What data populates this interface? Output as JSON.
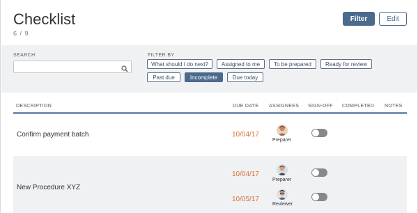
{
  "header": {
    "title": "Checklist",
    "count": "6 / 9"
  },
  "toolbar": {
    "filter_label": "Filter",
    "edit_label": "Edit"
  },
  "filters": {
    "search_label": "SEARCH",
    "search_value": "",
    "filter_by_label": "FILTER BY",
    "chips": [
      {
        "label": "What should I do next?",
        "active": false
      },
      {
        "label": "Assigned to me",
        "active": false
      },
      {
        "label": "To be prepared",
        "active": false
      },
      {
        "label": "Ready for review",
        "active": false
      },
      {
        "label": "Past due",
        "active": false
      },
      {
        "label": "Incomplete",
        "active": true
      },
      {
        "label": "Due today",
        "active": false
      }
    ]
  },
  "table": {
    "columns": [
      "DESCRIPTION",
      "DUE DATE",
      "ASSIGNEES",
      "SIGN-OFF",
      "COMPLETED",
      "NOTES"
    ],
    "rows": [
      {
        "description": "Confirm payment batch",
        "assignments": [
          {
            "due_date": "10/04/17",
            "role": "Preparer",
            "signed_off": false
          }
        ]
      },
      {
        "description": "New Procedure XYZ",
        "assignments": [
          {
            "due_date": "10/04/17",
            "role": "Preparer",
            "signed_off": false
          },
          {
            "due_date": "10/05/17",
            "role": "Reviewer",
            "signed_off": false
          }
        ]
      }
    ]
  },
  "colors": {
    "accent": "#4a6a8e",
    "due_date": "#d9703a",
    "header_rule": "#7b93b3",
    "toggle_off": "#888888"
  }
}
